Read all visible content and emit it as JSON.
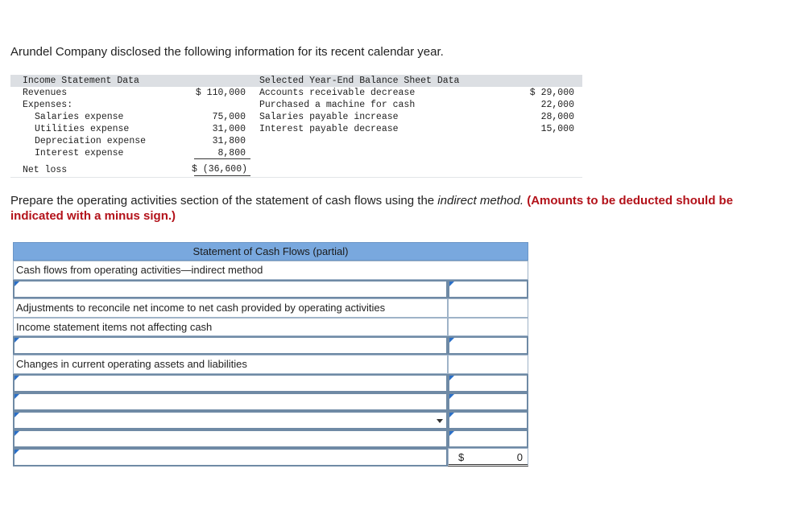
{
  "intro": "Arundel Company disclosed the following information for its recent calendar year.",
  "income": {
    "header": "Income Statement Data",
    "revenues_label": "Revenues",
    "revenues_value": "$ 110,000",
    "expenses_label": "Expenses:",
    "salaries_label": "Salaries expense",
    "salaries_value": "75,000",
    "utilities_label": "Utilities expense",
    "utilities_value": "31,000",
    "depreciation_label": "Depreciation expense",
    "depreciation_value": "31,800",
    "interest_label": "Interest expense",
    "interest_value": "8,800",
    "netloss_label": "Net loss",
    "netloss_value": "$ (36,600)"
  },
  "balance": {
    "header": "Selected Year-End Balance Sheet Data",
    "ar_label": "Accounts receivable decrease",
    "ar_value": "$ 29,000",
    "machine_label": "Purchased a machine for cash",
    "machine_value": "22,000",
    "salpay_label": "Salaries payable increase",
    "salpay_value": "28,000",
    "intpay_label": "Interest payable decrease",
    "intpay_value": "15,000"
  },
  "instructions": {
    "part1": "Prepare the operating activities section of the statement of cash flows using the ",
    "method": "indirect method.",
    "note": "(Amounts to be deducted should be indicated with a minus sign.)"
  },
  "statement": {
    "title": "Statement of Cash Flows (partial)",
    "section_label": "Cash flows from operating activities—indirect method",
    "adjustments_label": "Adjustments to reconcile net income to net cash provided by operating activities",
    "income_items_label": "Income statement items not affecting cash",
    "changes_label": "Changes in current operating assets and liabilities",
    "total_currency": "$",
    "total_value": "0"
  },
  "colors": {
    "header_blue": "#79a8de",
    "marker_blue": "#2a6fc7",
    "note_red": "#b3121a"
  }
}
